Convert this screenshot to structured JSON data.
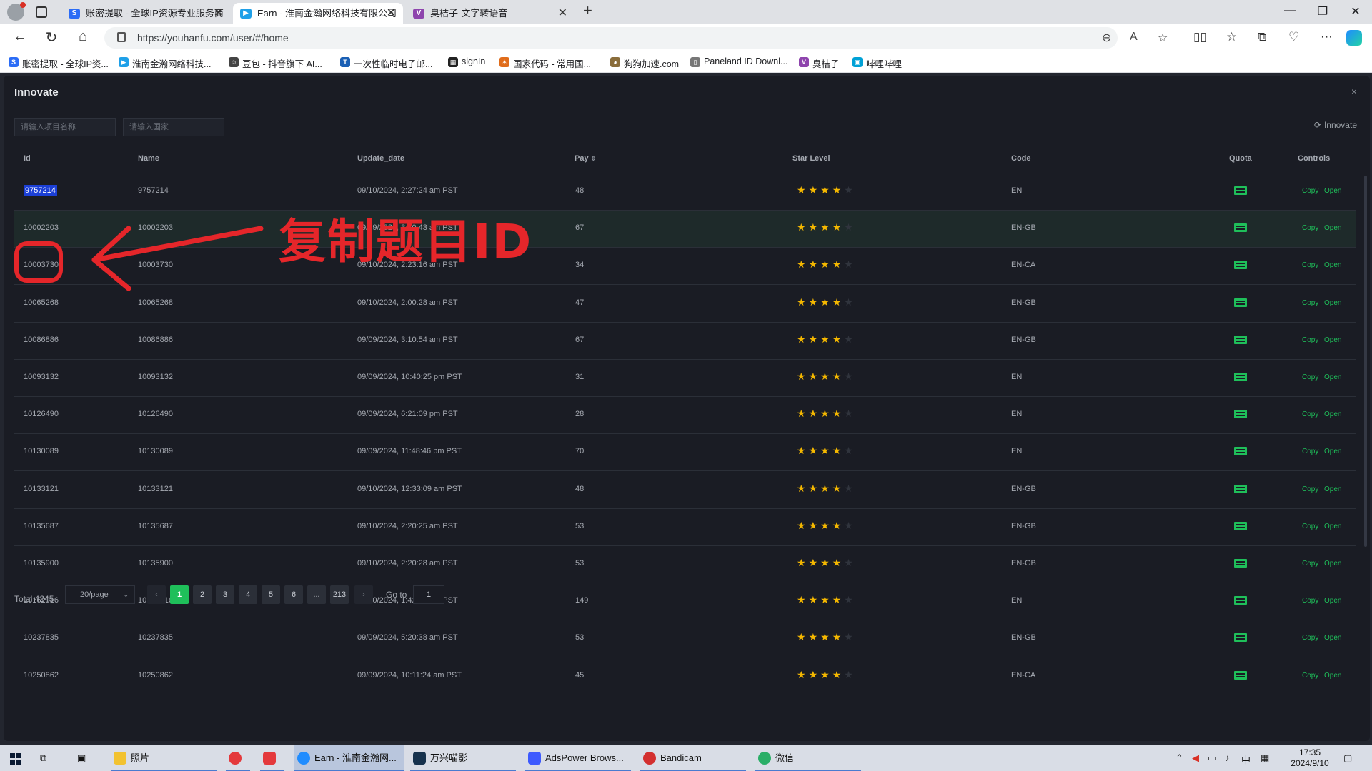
{
  "browser": {
    "tabs": [
      {
        "title": "账密提取 - 全球IP资源专业服务商",
        "active": false,
        "icon_color": "#2b6cf6",
        "icon_letter": "S"
      },
      {
        "title": "Earn - 淮南金瀚网络科技有限公司",
        "active": true,
        "icon_color": "#1fa0e8",
        "icon_letter": "▶"
      },
      {
        "title": "臭桔子-文字转语音",
        "active": false,
        "icon_color": "#8e44ad",
        "icon_letter": "V"
      }
    ],
    "url": "https://youhanfu.com/user/#/home",
    "bookmarks": [
      {
        "label": "账密提取 - 全球IP资...",
        "icon_color": "#2b6cf6",
        "icon_letter": "S"
      },
      {
        "label": "淮南金瀚网络科技...",
        "icon_color": "#1fa0e8",
        "icon_letter": "▶"
      },
      {
        "label": "豆包 - 抖音旗下 AI...",
        "icon_color": "#444444",
        "icon_letter": "☺"
      },
      {
        "label": "一次性临时电子邮...",
        "icon_color": "#1a5fb4",
        "icon_letter": "T"
      },
      {
        "label": "signIn",
        "icon_color": "#222222",
        "icon_letter": "▦"
      },
      {
        "label": "国家代码 - 常用国...",
        "icon_color": "#e06c1b",
        "icon_letter": "✶"
      },
      {
        "label": "狗狗加速.com",
        "icon_color": "#8a6d3b",
        "icon_letter": "◕"
      },
      {
        "label": "Paneland ID Downl...",
        "icon_color": "#777777",
        "icon_letter": "▯"
      },
      {
        "label": "臭桔子",
        "icon_color": "#8e44ad",
        "icon_letter": "V"
      },
      {
        "label": "哔哩哔哩",
        "icon_color": "#00a1d6",
        "icon_letter": "▣"
      }
    ]
  },
  "app": {
    "title": "Innovate",
    "close_icon": "×",
    "filters": {
      "project_placeholder": "请输入项目名称",
      "country_placeholder": "请输入国家"
    },
    "refresh_label": "Innovate",
    "columns": {
      "id": "Id",
      "name": "Name",
      "update_date": "Update_date",
      "pay": "Pay",
      "star_level": "Star Level",
      "code": "Code",
      "quota": "Quota",
      "controls": "Controls"
    },
    "rows": [
      {
        "id": "9757214",
        "name": "9757214",
        "date": "09/10/2024, 2:27:24 am PST",
        "pay": "48",
        "stars": 4,
        "code": "EN",
        "selected": true
      },
      {
        "id": "10002203",
        "name": "10002203",
        "date": "09/09/2024, 3:10:43 am PST",
        "pay": "67",
        "stars": 4,
        "code": "EN-GB",
        "hover": true
      },
      {
        "id": "10003730",
        "name": "10003730",
        "date": "09/10/2024, 2:23:16 am PST",
        "pay": "34",
        "stars": 4,
        "code": "EN-CA"
      },
      {
        "id": "10065268",
        "name": "10065268",
        "date": "09/10/2024, 2:00:28 am PST",
        "pay": "47",
        "stars": 4,
        "code": "EN-GB"
      },
      {
        "id": "10086886",
        "name": "10086886",
        "date": "09/09/2024, 3:10:54 am PST",
        "pay": "67",
        "stars": 4,
        "code": "EN-GB"
      },
      {
        "id": "10093132",
        "name": "10093132",
        "date": "09/09/2024, 10:40:25 pm PST",
        "pay": "31",
        "stars": 4,
        "code": "EN"
      },
      {
        "id": "10126490",
        "name": "10126490",
        "date": "09/09/2024, 6:21:09 pm PST",
        "pay": "28",
        "stars": 4,
        "code": "EN"
      },
      {
        "id": "10130089",
        "name": "10130089",
        "date": "09/09/2024, 11:48:46 pm PST",
        "pay": "70",
        "stars": 4,
        "code": "EN"
      },
      {
        "id": "10133121",
        "name": "10133121",
        "date": "09/10/2024, 12:33:09 am PST",
        "pay": "48",
        "stars": 4,
        "code": "EN-GB"
      },
      {
        "id": "10135687",
        "name": "10135687",
        "date": "09/10/2024, 2:20:25 am PST",
        "pay": "53",
        "stars": 4,
        "code": "EN-GB"
      },
      {
        "id": "10135900",
        "name": "10135900",
        "date": "09/10/2024, 2:20:28 am PST",
        "pay": "53",
        "stars": 4,
        "code": "EN-GB"
      },
      {
        "id": "10162916",
        "name": "10162916",
        "date": "09/10/2024, 1:42:44 am PST",
        "pay": "149",
        "stars": 4,
        "code": "EN"
      },
      {
        "id": "10237835",
        "name": "10237835",
        "date": "09/09/2024, 5:20:38 am PST",
        "pay": "53",
        "stars": 4,
        "code": "EN-GB"
      },
      {
        "id": "10250862",
        "name": "10250862",
        "date": "09/09/2024, 10:11:24 am PST",
        "pay": "45",
        "stars": 4,
        "code": "EN-CA"
      }
    ],
    "controls": {
      "copy": "Copy",
      "open": "Open"
    },
    "pagination": {
      "total": "Total 4245",
      "page_size": "20/page",
      "pages": [
        "1",
        "2",
        "3",
        "4",
        "5",
        "6",
        "...",
        "213"
      ],
      "current": "1",
      "goto_label": "Go to",
      "goto_value": "1"
    }
  },
  "annotation": {
    "text": "复制题目ID",
    "color": "#e5262a"
  },
  "taskbar": {
    "items": [
      {
        "label": "照片",
        "icon_color": "#f2c230"
      },
      {
        "label": "",
        "icon_color": "#e4393c"
      },
      {
        "label": "",
        "icon_color": "#e4393c"
      },
      {
        "label": "Earn - 淮南金瀚网...",
        "icon_color": "#1f8cff"
      },
      {
        "label": "万兴喵影",
        "icon_color": "#17324d"
      },
      {
        "label": "AdsPower Brows...",
        "icon_color": "#3d5afe"
      },
      {
        "label": "Bandicam",
        "icon_color": "#d32f2f"
      },
      {
        "label": "微信",
        "icon_color": "#2aae67"
      }
    ],
    "ime": "中",
    "time": "17:35",
    "date": "2024/9/10"
  }
}
